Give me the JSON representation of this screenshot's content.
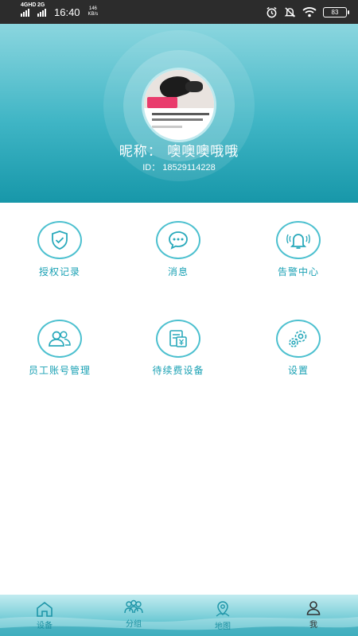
{
  "status_bar": {
    "network_1": "4GHD",
    "network_2": "2G",
    "time": "16:40",
    "speed_value": "146",
    "speed_unit": "KB/s",
    "battery": "83"
  },
  "profile": {
    "nickname": "昵称：  噢噢噢哦哦",
    "id_label": "ID：",
    "id_value": "18529114228"
  },
  "menu": [
    {
      "label": "授权记录",
      "icon": "shield-check-icon"
    },
    {
      "label": "消息",
      "icon": "message-icon"
    },
    {
      "label": "告警中心",
      "icon": "alarm-bell-icon"
    },
    {
      "label": "员工账号管理",
      "icon": "users-icon"
    },
    {
      "label": "待续费设备",
      "icon": "renewal-icon"
    },
    {
      "label": "设置",
      "icon": "settings-gear-icon"
    }
  ],
  "bottom_nav": [
    {
      "label": "设备",
      "icon": "home-icon",
      "active": false
    },
    {
      "label": "分组",
      "icon": "group-icon",
      "active": false
    },
    {
      "label": "地图",
      "icon": "map-pin-icon",
      "active": false
    },
    {
      "label": "我",
      "icon": "person-icon",
      "active": true
    }
  ],
  "colors": {
    "accent": "#1aa1b4",
    "icon_ring": "#4cc0cf",
    "header_top": "#8bd6df",
    "header_bottom": "#1797a9"
  }
}
